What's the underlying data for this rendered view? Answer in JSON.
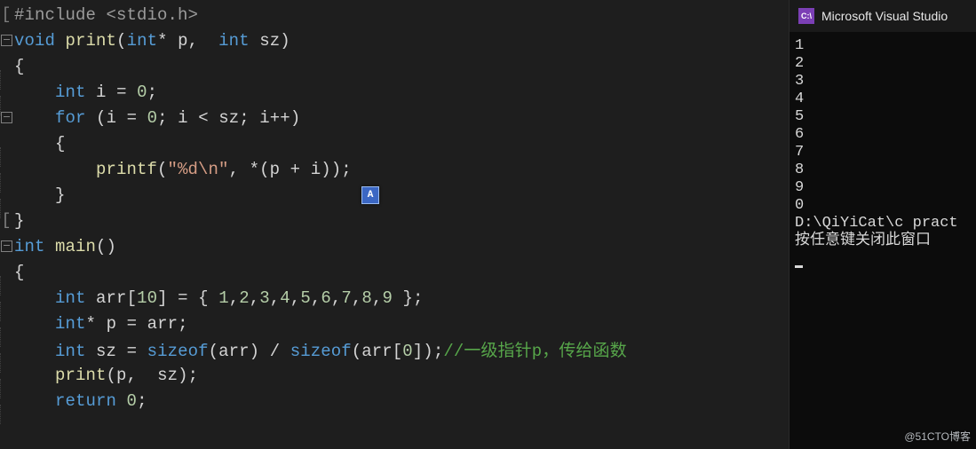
{
  "editor": {
    "filename_hint": "source.c",
    "lines": [
      {
        "fold": "bracket",
        "html": "<span class='inc'>#include &lt;stdio.h&gt;</span>"
      },
      {
        "fold": "box",
        "html": "<span class='kw'>void</span> <span class='fn'>print</span><span class='paren'>(</span><span class='kw'>int</span><span class='op'>*</span> <span class='plain'>p</span><span class='op'>,</span>  <span class='kw'>int</span> <span class='plain'>sz</span><span class='paren'>)</span>"
      },
      {
        "fold": "line",
        "html": "<span class='plain'>{</span>"
      },
      {
        "fold": "line",
        "html": "    <span class='kw'>int</span> <span class='plain'>i</span> <span class='op'>=</span> <span class='num'>0</span><span class='op'>;</span>"
      },
      {
        "fold": "box",
        "html": "    <span class='kw'>for</span> <span class='paren'>(</span><span class='plain'>i</span> <span class='op'>=</span> <span class='num'>0</span><span class='op'>;</span> <span class='plain'>i</span> <span class='op'>&lt;</span> <span class='plain'>sz</span><span class='op'>;</span> <span class='plain'>i</span><span class='op'>++</span><span class='paren'>)</span>"
      },
      {
        "fold": "line",
        "html": "    <span class='plain'>{</span>"
      },
      {
        "fold": "line",
        "html": "        <span class='fn'>printf</span><span class='paren'>(</span><span class='str'>\"%d\\n\"</span><span class='op'>,</span> <span class='op'>*</span><span class='paren'>(</span><span class='plain'>p</span> <span class='op'>+</span> <span class='plain'>i</span><span class='paren'>))</span><span class='op'>;</span>"
      },
      {
        "fold": "line",
        "html": "    <span class='plain'>}</span>"
      },
      {
        "fold": "bracket",
        "html": "<span class='plain'>}</span>"
      },
      {
        "fold": "box",
        "html": "<span class='kw'>int</span> <span class='fn'>main</span><span class='paren'>()</span>"
      },
      {
        "fold": "line",
        "html": "<span class='plain'>{</span>"
      },
      {
        "fold": "line",
        "html": "    <span class='kw'>int</span> <span class='plain'>arr</span><span class='paren'>[</span><span class='num'>10</span><span class='paren'>]</span> <span class='op'>=</span> <span class='paren'>{</span> <span class='num'>1</span><span class='op'>,</span><span class='num'>2</span><span class='op'>,</span><span class='num'>3</span><span class='op'>,</span><span class='num'>4</span><span class='op'>,</span><span class='num'>5</span><span class='op'>,</span><span class='num'>6</span><span class='op'>,</span><span class='num'>7</span><span class='op'>,</span><span class='num'>8</span><span class='op'>,</span><span class='num'>9</span> <span class='paren'>}</span><span class='op'>;</span>"
      },
      {
        "fold": "line",
        "html": "    <span class='kw'>int</span><span class='op'>*</span> <span class='plain'>p</span> <span class='op'>=</span> <span class='plain'>arr</span><span class='op'>;</span>"
      },
      {
        "fold": "line",
        "html": "    <span class='kw'>int</span> <span class='plain'>sz</span> <span class='op'>=</span> <span class='kw'>sizeof</span><span class='paren'>(</span><span class='plain'>arr</span><span class='paren'>)</span> <span class='op'>/</span> <span class='kw'>sizeof</span><span class='paren'>(</span><span class='plain'>arr</span><span class='paren'>[</span><span class='num'>0</span><span class='paren'>])</span><span class='op'>;</span><span class='comment'>//一级指针p，传给函数</span>"
      },
      {
        "fold": "line",
        "html": "    <span class='fn'>print</span><span class='paren'>(</span><span class='plain'>p</span><span class='op'>,</span>  <span class='plain'>sz</span><span class='paren'>)</span><span class='op'>;</span>"
      },
      {
        "fold": "line",
        "html": "    <span class='kw'>return</span> <span class='num'>0</span><span class='op'>;</span>"
      }
    ],
    "ime_label": "A"
  },
  "side": {
    "title": "Microsoft Visual Studio",
    "console_output": [
      "1",
      "2",
      "3",
      "4",
      "5",
      "6",
      "7",
      "8",
      "9",
      "0",
      "",
      "D:\\QiYiCat\\c pract",
      "按任意键关闭此窗口"
    ]
  },
  "watermark": "@51CTO博客"
}
